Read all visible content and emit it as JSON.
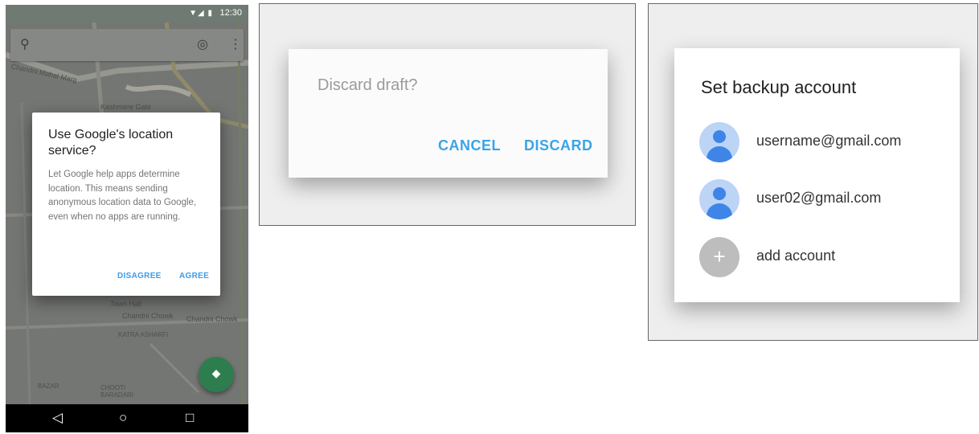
{
  "phone": {
    "status_time": "12:30",
    "status_icons": "▼◢ ▮",
    "map_labels": [
      "Chandni Mahal Marg",
      "Kashmere Gate",
      "Town Hall",
      "Chandni Chowk",
      "Chandni Chowk",
      "KATRA ASHARFI",
      "BAZAR",
      "CHOOTI BARADARI"
    ],
    "location_dialog": {
      "title": "Use Google's location service?",
      "body": "Let Google help apps determine location. This means sending anonymous location data to Google, even when no apps are running.",
      "disagree": "DISAGREE",
      "agree": "AGREE"
    },
    "fab_icon": "directions-icon",
    "nav": {
      "back": "◁",
      "home": "○",
      "recents": "□"
    }
  },
  "discard_dialog": {
    "title": "Discard draft?",
    "cancel": "CANCEL",
    "discard": "DISCARD"
  },
  "backup_dialog": {
    "title": "Set backup account",
    "accounts": [
      {
        "email": "username@gmail.com"
      },
      {
        "email": "user02@gmail.com"
      }
    ],
    "add_account": "add account"
  },
  "colors": {
    "accent_blue": "#39a4e8",
    "avatar_blue": "#3f85e8",
    "fab_green": "#2e7d4f"
  }
}
